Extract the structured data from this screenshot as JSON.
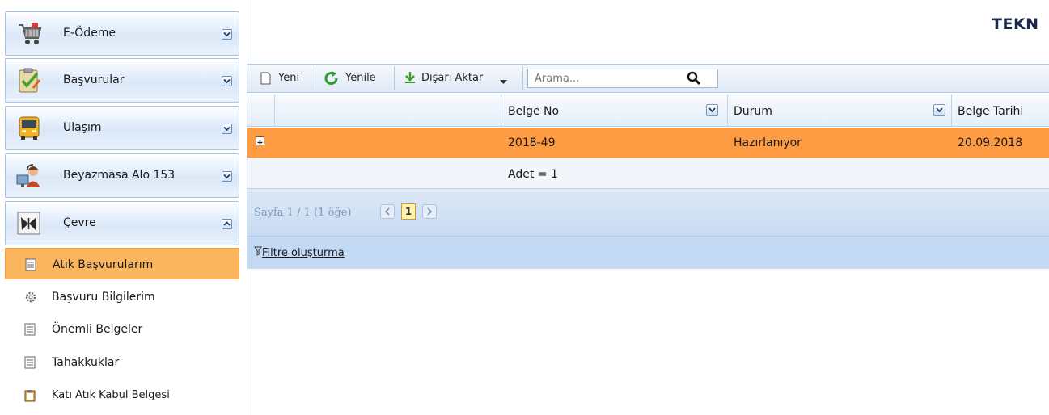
{
  "sidebar": {
    "panels": [
      {
        "label": "E-Ödeme",
        "icon": "cart-icon",
        "toggle": "expand"
      },
      {
        "label": "Başvurular",
        "icon": "clipboard-check-icon",
        "toggle": "expand"
      },
      {
        "label": "Ulaşım",
        "icon": "bus-icon",
        "toggle": "expand"
      },
      {
        "label": "Beyazmasa Alo 153",
        "icon": "support-agent-icon",
        "toggle": "expand"
      },
      {
        "label": "Çevre",
        "icon": "butterfly-icon",
        "toggle": "collapse"
      }
    ],
    "items": [
      {
        "label": "Atık Başvurularım",
        "icon": "document-icon",
        "active": true
      },
      {
        "label": "Başvuru Bilgilerim",
        "icon": "gear-icon",
        "active": false
      },
      {
        "label": "Önemli Belgeler",
        "icon": "document-icon",
        "active": false
      },
      {
        "label": "Tahakkuklar",
        "icon": "document-icon",
        "active": false
      },
      {
        "label": "Katı Atık Kabul Belgesi",
        "icon": "clipboard-icon",
        "active": false
      }
    ]
  },
  "header": {
    "title": "TEKN"
  },
  "toolbar": {
    "new_label": "Yeni",
    "refresh_label": "Yenile",
    "export_label": "Dışarı Aktar",
    "search_placeholder": "Arama..."
  },
  "grid": {
    "columns": [
      "Belge No",
      "Durum",
      "Belge Tarihi"
    ],
    "rows": [
      {
        "belge_no": "2018-49",
        "durum": "Hazırlanıyor",
        "belge_tarihi": "20.09.2018"
      }
    ],
    "footer_count": "Adet = 1"
  },
  "pager": {
    "text": "Sayfa 1 / 1 (1 öğe)",
    "current_page": "1"
  },
  "filter": {
    "link_label": "Filtre oluşturma"
  },
  "colors": {
    "active_item": "#fbb55e",
    "selected_row": "#fd9c42",
    "pager_bg": "#c9dcf3"
  }
}
